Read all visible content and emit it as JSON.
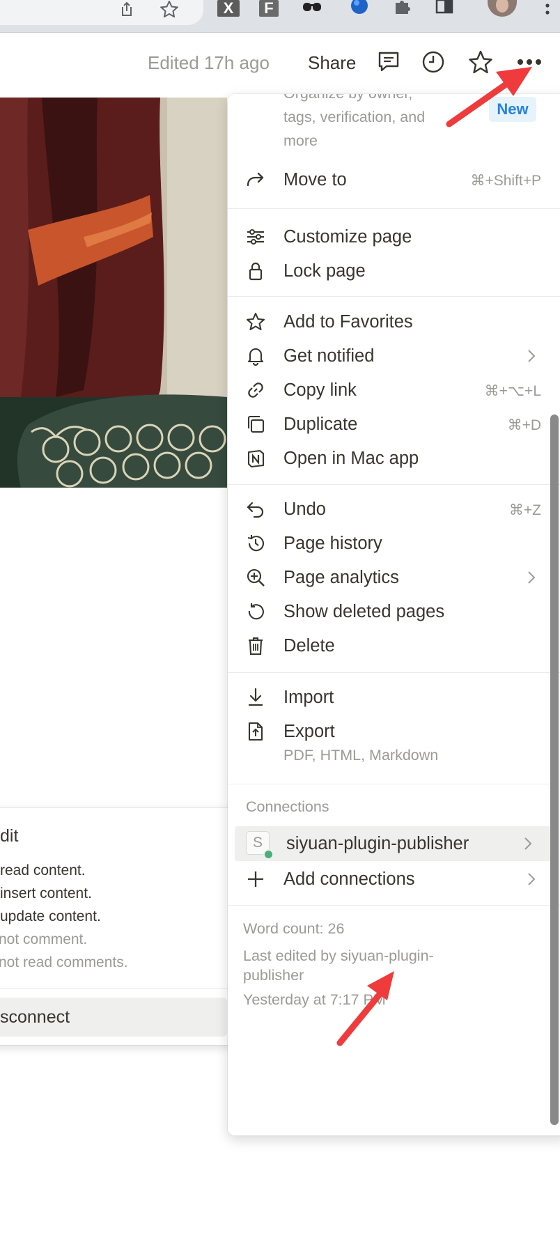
{
  "header": {
    "edited_text": "Edited 17h ago",
    "share_label": "Share"
  },
  "menu": {
    "top_snippet_lines": [
      "Organize by owner,",
      "tags, verification, and",
      "more"
    ],
    "new_badge": "New",
    "move_to": {
      "label": "Move to",
      "shortcut": "⌘+Shift+P"
    },
    "group2": [
      {
        "label": "Customize page",
        "icon": "sliders-icon"
      },
      {
        "label": "Lock page",
        "icon": "lock-icon"
      }
    ],
    "group3": [
      {
        "label": "Add to Favorites",
        "icon": "star-icon",
        "shortcut": ""
      },
      {
        "label": "Get notified",
        "icon": "bell-icon",
        "shortcut": ""
      },
      {
        "label": "Copy link",
        "icon": "link-icon",
        "shortcut": "⌘+⌥+L"
      },
      {
        "label": "Duplicate",
        "icon": "duplicate-icon",
        "shortcut": "⌘+D"
      },
      {
        "label": "Open in Mac app",
        "icon": "notion-icon",
        "shortcut": ""
      }
    ],
    "group4": [
      {
        "label": "Undo",
        "icon": "undo-icon",
        "shortcut": "⌘+Z"
      },
      {
        "label": "Page history",
        "icon": "history-icon",
        "shortcut": ""
      },
      {
        "label": "Page analytics",
        "icon": "analytics-icon",
        "shortcut": ""
      },
      {
        "label": "Show deleted pages",
        "icon": "restore-icon",
        "shortcut": ""
      },
      {
        "label": "Delete",
        "icon": "trash-icon",
        "shortcut": ""
      }
    ],
    "import_label": "Import",
    "export_label": "Export",
    "export_sub": "PDF, HTML, Markdown",
    "connections_heading": "Connections",
    "connection": {
      "initial": "S",
      "name": "siyuan-plugin-publisher"
    },
    "add_connections": "Add connections",
    "footer": {
      "word_count": "Word count: 26",
      "last_edited_line1": "Last edited by siyuan-plugin-",
      "last_edited_line2": "publisher",
      "timestamp": "Yesterday at 7:17 PM"
    }
  },
  "connection_popup": {
    "title": "dit",
    "permissions": [
      {
        "text": "read content.",
        "muted": false
      },
      {
        "text": "insert content.",
        "muted": false
      },
      {
        "text": "update content.",
        "muted": false
      },
      {
        "text": "not comment.",
        "muted": true
      },
      {
        "text": "not read comments.",
        "muted": true
      }
    ],
    "disconnect": "sconnect"
  },
  "colors": {
    "accent": "#2383e2",
    "arrow": "#ef3b3b",
    "muted_text": "#9b9a97",
    "text": "#37352f"
  }
}
